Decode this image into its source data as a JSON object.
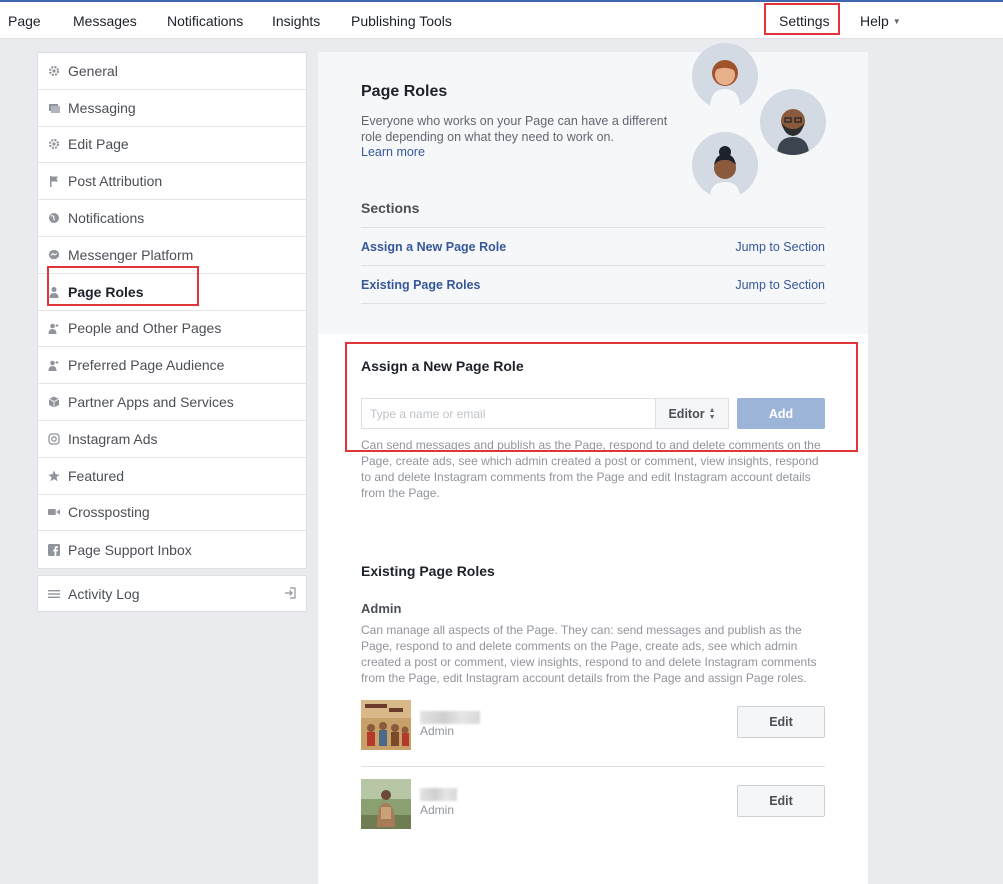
{
  "topnav": {
    "page": "Page",
    "messages": "Messages",
    "notifications": "Notifications",
    "insights": "Insights",
    "publishing_tools": "Publishing Tools",
    "settings": "Settings",
    "help": "Help"
  },
  "sidebar": {
    "items": [
      {
        "label": "General",
        "icon": "gear-icon"
      },
      {
        "label": "Messaging",
        "icon": "message-icon"
      },
      {
        "label": "Edit Page",
        "icon": "gear-icon"
      },
      {
        "label": "Post Attribution",
        "icon": "flag-icon"
      },
      {
        "label": "Notifications",
        "icon": "globe-icon"
      },
      {
        "label": "Messenger Platform",
        "icon": "messenger-icon"
      },
      {
        "label": "Page Roles",
        "icon": "person-icon",
        "active": true
      },
      {
        "label": "People and Other Pages",
        "icon": "people-icon"
      },
      {
        "label": "Preferred Page Audience",
        "icon": "people-icon"
      },
      {
        "label": "Partner Apps and Services",
        "icon": "cube-icon"
      },
      {
        "label": "Instagram Ads",
        "icon": "instagram-icon"
      },
      {
        "label": "Featured",
        "icon": "star-icon"
      },
      {
        "label": "Crossposting",
        "icon": "video-icon"
      },
      {
        "label": "Page Support Inbox",
        "icon": "facebook-icon"
      }
    ],
    "activity_log": "Activity Log"
  },
  "hero": {
    "title": "Page Roles",
    "description": "Everyone who works on your Page can have a different role depending on what they need to work on.",
    "learn_more": "Learn more"
  },
  "sections": {
    "title": "Sections",
    "rows": [
      {
        "label": "Assign a New Page Role",
        "jump": "Jump to Section"
      },
      {
        "label": "Existing Page Roles",
        "jump": "Jump to Section"
      }
    ]
  },
  "assign": {
    "title": "Assign a New Page Role",
    "placeholder": "Type a name or email",
    "role": "Editor",
    "add_label": "Add",
    "description": "Can send messages and publish as the Page, respond to and delete comments on the Page, create ads, see which admin created a post or comment, view insights, respond to and delete Instagram comments from the Page and edit Instagram account details from the Page."
  },
  "existing": {
    "title": "Existing Page Roles",
    "admin_heading": "Admin",
    "admin_description": "Can manage all aspects of the Page. They can: send messages and publish as the Page, respond to and delete comments on the Page, create ads, see which admin created a post or comment, view insights, respond to and delete Instagram comments from the Page, edit Instagram account details from the Page and assign Page roles.",
    "people": [
      {
        "role": "Admin",
        "edit_label": "Edit"
      },
      {
        "role": "Admin",
        "edit_label": "Edit"
      }
    ]
  },
  "colors": {
    "link": "#365899",
    "highlight": "#e0353b",
    "add_button": "#9cb4d8"
  }
}
